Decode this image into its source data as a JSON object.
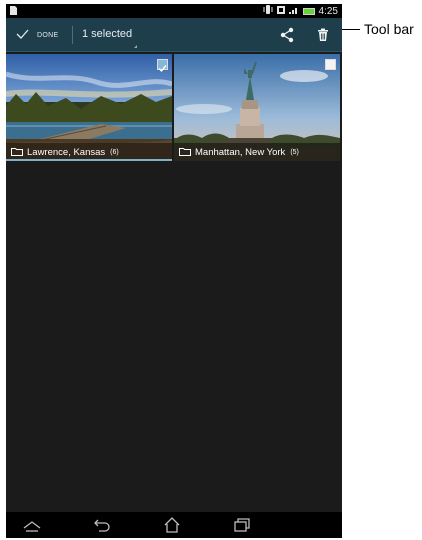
{
  "status_bar": {
    "time": "4:25",
    "icons": [
      "notification-icon",
      "vibrate-icon",
      "network-icon",
      "signal-icon",
      "battery-icon"
    ],
    "battery_color": "#6ad13a"
  },
  "toolbar": {
    "done_label": "DONE",
    "selected_label": "1 selected",
    "actions": [
      "share-icon",
      "delete-icon"
    ],
    "background": "#1e3e4b"
  },
  "albums": [
    {
      "name": "Lawrence, Kansas",
      "count": "(6)",
      "selected": true
    },
    {
      "name": "Manhattan, New York",
      "count": "(5)",
      "selected": false
    }
  ],
  "nav_bar": {
    "buttons": [
      "recent-tasks-icon",
      "back-icon",
      "home-icon",
      "overview-icon"
    ]
  },
  "callout": {
    "label": "Tool bar"
  },
  "colors": {
    "selection_accent": "#86b7d4",
    "grid_background": "#1b1b1b"
  }
}
